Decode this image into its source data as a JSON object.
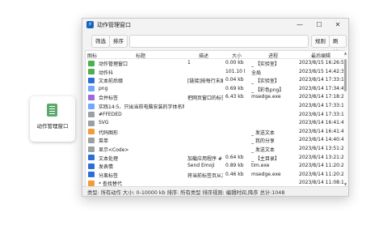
{
  "desktop_icon": {
    "label": "动作管理窗口"
  },
  "window": {
    "title": "动作管理窗口",
    "controls": {
      "minimize": "—",
      "maximize": "☐",
      "close": "✕"
    }
  },
  "toolbar": {
    "filter_label": "筛选",
    "sort_label": "排序",
    "search_value": "",
    "rules_label": "规则",
    "refresh_label": "刷新"
  },
  "table": {
    "columns": [
      "图标",
      "标题",
      "描述",
      "大小",
      "进程",
      "最后编辑"
    ],
    "rows": [
      {
        "icon": "green",
        "title": "动作管理窗口",
        "desc": "1",
        "size": "0.00 kb",
        "process": "_ 【实验室】",
        "time": "2023/8/15 16:26:53"
      },
      {
        "icon": "green",
        "title": "动作抖",
        "desc": "",
        "size": "101.10 kb",
        "process": "全局",
        "time": "2023/8/15 14:42:32"
      },
      {
        "icon": "blue",
        "title": "文本前后缀",
        "desc": "[链接]按每行末尾",
        "size": "0.04 kb",
        "process": "_ 【实验室】",
        "time": "2023/8/14 17:33:18"
      },
      {
        "icon": "lightblue",
        "title": "png",
        "desc": "",
        "size": "0.69 kb",
        "process": "_ 【彩色png】",
        "time": "2023/8/14 17:34:43"
      },
      {
        "icon": "purple",
        "title": "合并标签",
        "desc": "把网页窗口的标签",
        "size": "6.43 kb",
        "process": "msedge.exe",
        "time": "2023/8/14 17:18:26"
      },
      {
        "icon": "lightblue",
        "title": "实践14:5、只出当前电脑安装的字体名称",
        "desc": "",
        "size": "",
        "process": "",
        "time": "2023/8/14 17:33:11"
      },
      {
        "icon": "gray",
        "title": "#FFEDED",
        "desc": "",
        "size": "",
        "process": "",
        "time": "2023/8/14 17:33:11"
      },
      {
        "icon": "gray",
        "title": "SVG",
        "desc": "",
        "size": "",
        "process": "",
        "time": "2023/8/14 16:41:44"
      },
      {
        "icon": "orange",
        "title": "代码图形",
        "desc": "",
        "size": "",
        "process": "_ 发送文本",
        "time": "2023/8/14 16:41:44"
      },
      {
        "icon": "gray",
        "title": "菜单",
        "desc": "",
        "size": "",
        "process": "_ 我的分享",
        "time": "2023/8/14 14:40:49"
      },
      {
        "icon": "gray",
        "title": "显示<Code>",
        "desc": "",
        "size": "",
        "process": "_ 发送文本",
        "time": "2023/8/14 13:51:28"
      },
      {
        "icon": "blue",
        "title": "文本处理",
        "desc": "加载应用程序 #",
        "size": "0.64 kb",
        "process": "_ 【主目录】",
        "time": "2023/8/14 13:21:22"
      },
      {
        "icon": "blue",
        "title": "发表情",
        "desc": "Send Emoji",
        "size": "0.89 kb",
        "process": "tim.exe",
        "time": "2023/8/14 11:20:22"
      },
      {
        "icon": "blue",
        "title": "分离标签",
        "desc": "将当前标签页从浏",
        "size": "0.46 kb",
        "process": "msedge.exe",
        "time": "2023/8/14 11:20:22"
      },
      {
        "icon": "orange",
        "title": "* 查找替代",
        "desc": "",
        "size": "",
        "process": "",
        "time": "2023/8/14 11:08:16"
      }
    ]
  },
  "icon_colors": {
    "green": "#4caf50",
    "blue": "#2b6fd6",
    "lightblue": "#6fa8ff",
    "purple": "#9c6ade",
    "gray": "#9aa0a6",
    "orange": "#f29b38"
  },
  "status_bar": {
    "text": "类型: 所有动作  大小: 0-10000 kb  排序: 所有类型  排序规则: 编辑时间,降序  总计:1048"
  }
}
